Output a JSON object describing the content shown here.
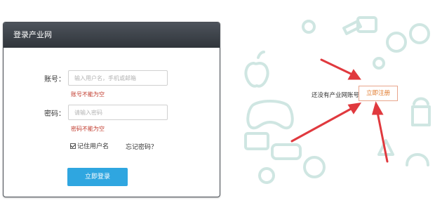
{
  "login": {
    "title": "登录产业网",
    "username_label": "账号：",
    "username_placeholder": "输入用户名，手机或邮箱",
    "username_error": "账号不能为空",
    "password_label": "密码：",
    "password_placeholder": "请输入密码",
    "password_error": "密码不能为空",
    "remember_label": "记住用户名",
    "forgot_label": "忘记密码？",
    "submit_label": "立即登录"
  },
  "register": {
    "prompt": "还没有产业网账号？",
    "link_label": "立即注册"
  },
  "colors": {
    "header_bg": "#3a3f45",
    "button_bg": "#2fa6e0",
    "error": "#c0392b",
    "register_link": "#e07a2c",
    "arrow": "#e0393e",
    "doodle": "#cfe6e2"
  }
}
